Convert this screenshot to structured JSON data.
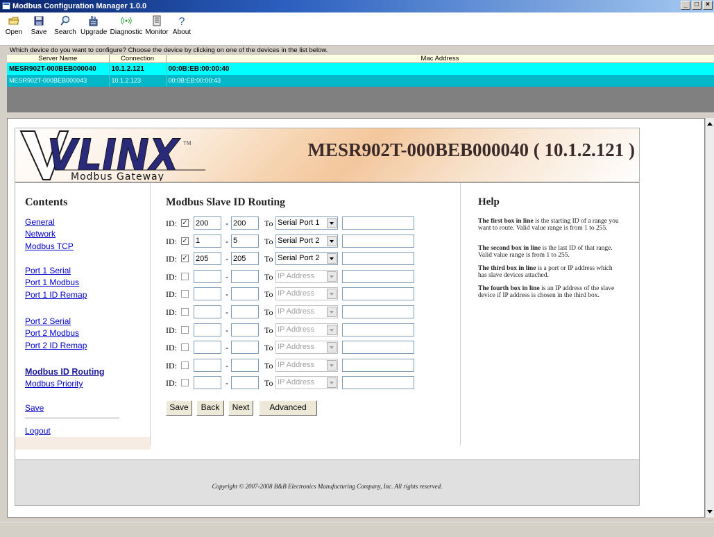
{
  "window": {
    "title": "Modbus Configuration Manager 1.0.0"
  },
  "toolbar": [
    {
      "label": "Open",
      "icon": "folder-icon"
    },
    {
      "label": "Save",
      "icon": "floppy-icon"
    },
    {
      "label": "Search",
      "icon": "search-icon"
    },
    {
      "label": "Upgrade",
      "icon": "upgrade-icon"
    },
    {
      "label": "Diagnostic",
      "icon": "signal-icon"
    },
    {
      "label": "Monitor",
      "icon": "monitor-icon"
    },
    {
      "label": "About",
      "icon": "help-icon"
    }
  ],
  "instructions": "Which device do you want to configure? Choose the device by clicking on one of the devices in the list below.",
  "device_list": {
    "columns": [
      "Server Name",
      "Connection",
      "Mac Address"
    ],
    "rows": [
      {
        "name": "MESR902T-000BEB000040",
        "connection": "10.1.2.121",
        "mac": "00:0B:EB:00:00:40",
        "selected": true
      },
      {
        "name": "MESR902T-000BEB000043",
        "connection": "10.1.2.123",
        "mac": "00:0B:EB:00:00:43",
        "selected": false
      }
    ]
  },
  "webpage": {
    "logo": {
      "brand": "VLINX",
      "tm": "TM",
      "subtitle": "Modbus Gateway"
    },
    "device_title": "MESR902T-000BEB000040 ( 10.1.2.121 )",
    "sidebar": {
      "heading": "Contents",
      "links": {
        "general": "General",
        "network": "Network",
        "modbus_tcp": "Modbus TCP",
        "port1_serial": "Port 1 Serial",
        "port1_modbus": "Port 1 Modbus",
        "port1_id_remap": "Port 1 ID Remap",
        "port2_serial": "Port 2 Serial",
        "port2_modbus": "Port 2 Modbus",
        "port2_id_remap": "Port 2 ID Remap",
        "modbus_id_routing": "Modbus ID Routing",
        "modbus_priority": "Modbus Priority",
        "save": "Save",
        "logout": "Logout"
      }
    },
    "main": {
      "heading": "Modbus Slave ID Routing",
      "id_label": "ID:",
      "to_label": "To",
      "routes": [
        {
          "checked": true,
          "from": "200",
          "to": "200",
          "target": "Serial Port 1",
          "ip": ""
        },
        {
          "checked": true,
          "from": "1",
          "to": "5",
          "target": "Serial Port 2",
          "ip": ""
        },
        {
          "checked": true,
          "from": "205",
          "to": "205",
          "target": "Serial Port 2",
          "ip": ""
        },
        {
          "checked": false,
          "from": "",
          "to": "",
          "target": "IP Address",
          "ip": ""
        },
        {
          "checked": false,
          "from": "",
          "to": "",
          "target": "IP Address",
          "ip": ""
        },
        {
          "checked": false,
          "from": "",
          "to": "",
          "target": "IP Address",
          "ip": ""
        },
        {
          "checked": false,
          "from": "",
          "to": "",
          "target": "IP Address",
          "ip": ""
        },
        {
          "checked": false,
          "from": "",
          "to": "",
          "target": "IP Address",
          "ip": ""
        },
        {
          "checked": false,
          "from": "",
          "to": "",
          "target": "IP Address",
          "ip": ""
        },
        {
          "checked": false,
          "from": "",
          "to": "",
          "target": "IP Address",
          "ip": ""
        }
      ],
      "buttons": {
        "save": "Save",
        "back": "Back",
        "next": "Next",
        "advanced": "Advanced"
      }
    },
    "help": {
      "heading": "Help",
      "paragraphs": [
        {
          "bold": "The first box in line",
          "text": " is the starting ID of a range you want to route. Valid value range is from 1 to 255."
        },
        {
          "bold": "The second box in line",
          "text": " is the last ID of that range. Valid value range is from 1 to 255."
        },
        {
          "bold": "The third box in line",
          "text": " is a port or IP address which has slave devices attached."
        },
        {
          "bold": "The fourth box in line",
          "text": " is an IP address of the slave device if IP address is chosen in the third box."
        }
      ]
    },
    "footer": "Copyright © 2007-2008 B&B Electronics Manufacturing Company, Inc. All rights reserved."
  },
  "colors": {
    "selected_row": "#00ffff",
    "row": "#00b8c8",
    "link": "#0000cc"
  }
}
